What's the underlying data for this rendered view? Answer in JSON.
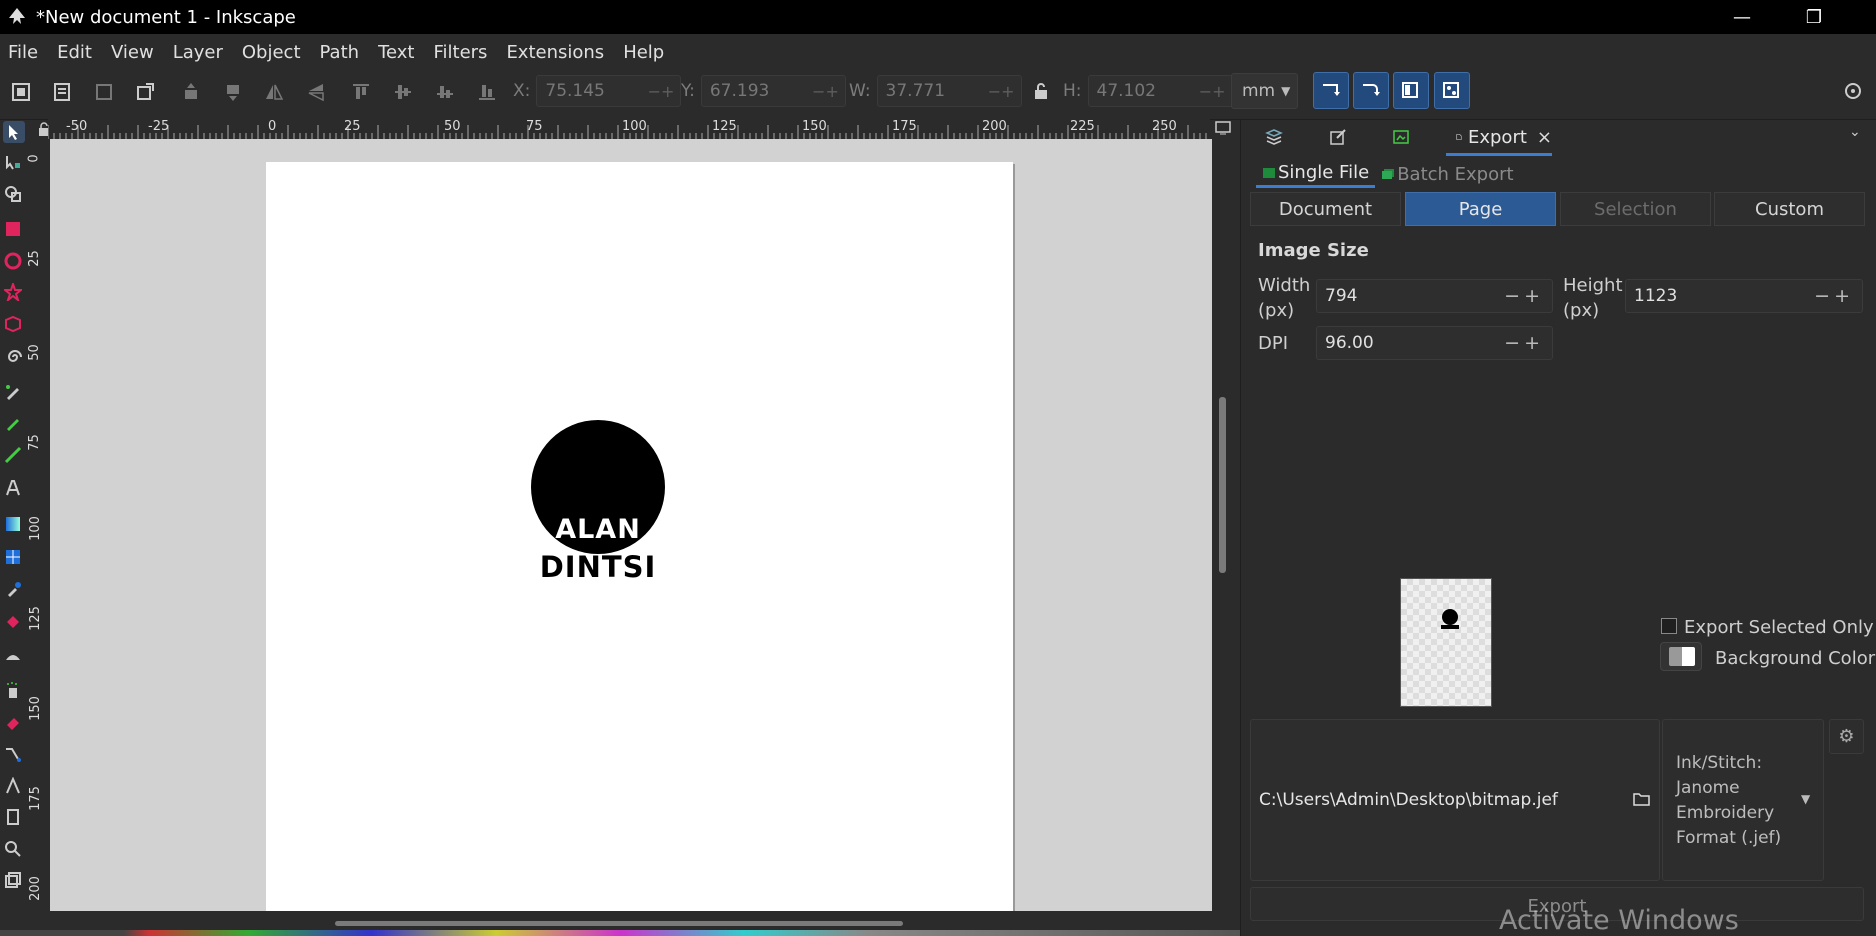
{
  "window": {
    "title": "*New document 1 - Inkscape",
    "minimize": "—",
    "restore": "❐"
  },
  "menu": [
    "File",
    "Edit",
    "View",
    "Layer",
    "Object",
    "Path",
    "Text",
    "Filters",
    "Extensions",
    "Help"
  ],
  "toolbar": {
    "x_label": "X:",
    "x_value": "75.145",
    "y_label": "Y:",
    "y_value": "67.193",
    "w_label": "W:",
    "w_value": "37.771",
    "h_label": "H:",
    "h_value": "47.102",
    "pm": "−+",
    "unit": "mm"
  },
  "rulers": {
    "horizontal": [
      "-50",
      "-25",
      "0",
      "25",
      "50",
      "75",
      "100",
      "125",
      "150",
      "175",
      "200",
      "225",
      "250"
    ],
    "vertical": [
      "0",
      "25",
      "50",
      "75",
      "100",
      "125",
      "150",
      "175",
      "200"
    ]
  },
  "canvas": {
    "logo_top": "ALAN",
    "logo_bottom": "DINTSI"
  },
  "dock": {
    "export_tab": "Export",
    "close": "×",
    "subtabs": {
      "single": "Single File",
      "batch": "Batch Export"
    },
    "areas": {
      "document": "Document",
      "page": "Page",
      "selection": "Selection",
      "custom": "Custom"
    },
    "image_size_heading": "Image Size",
    "width_label": "Width",
    "width_unit": "(px)",
    "width_value": "794",
    "height_label": "Height",
    "height_unit": "(px)",
    "height_value": "1123",
    "dpi_label": "DPI",
    "dpi_value": "96.00",
    "pm": "−+",
    "export_selected_only": "Export Selected Only",
    "background_color": "Background Color",
    "file_path": "C:\\Users\\Admin\\Desktop\\bitmap.jef",
    "format_text": "Ink/Stitch: Janome Embroidery Format (.jef)",
    "export_button": "Export"
  },
  "watermark": "Activate Windows",
  "colors": {
    "accent": "#3d7dd1",
    "active_button": "#2c5a94",
    "background": "#2b2b2b"
  }
}
